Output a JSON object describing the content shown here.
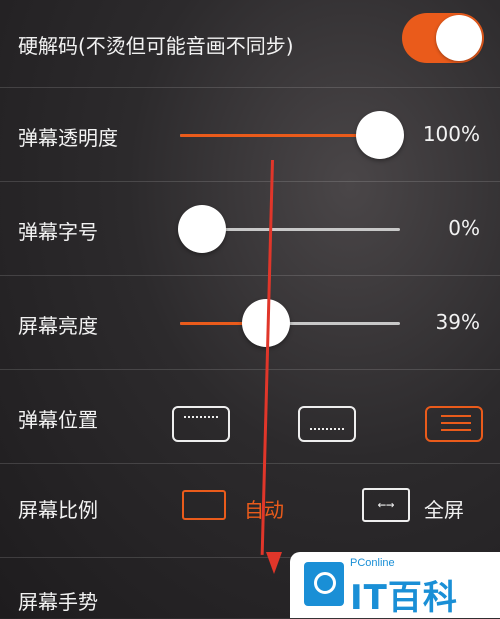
{
  "settings": {
    "hw_decode": {
      "label": "硬解码(不烫但可能音画不同步)",
      "enabled": true
    },
    "danmaku_opacity": {
      "label": "弹幕透明度",
      "value": "100%",
      "level": 1.0
    },
    "danmaku_font": {
      "label": "弹幕字号",
      "value": "0%",
      "level": 0.0
    },
    "brightness": {
      "label": "屏幕亮度",
      "value": "39%",
      "level": 0.39
    },
    "danmaku_position": {
      "label": "弹幕位置",
      "options": [
        "top",
        "bottom",
        "scroll"
      ],
      "selected": "scroll"
    },
    "aspect_ratio": {
      "label": "屏幕比例",
      "auto_label": "自动",
      "full_label": "全屏",
      "full_icon": "←→",
      "selected": "auto"
    },
    "gesture": {
      "label": "屏幕手势"
    }
  },
  "watermark": {
    "sub": "PConline",
    "main": "IT百科"
  },
  "colors": {
    "accent": "#ea5b1b",
    "annotation": "#e0362a",
    "brand": "#1a8fd6"
  }
}
